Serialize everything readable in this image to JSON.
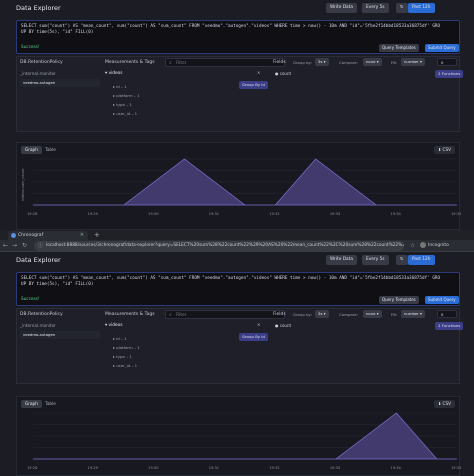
{
  "app": {
    "title": "Data Explorer",
    "write_data": "Write Data",
    "refresh": "Every 5s",
    "time_range": "Past 12h"
  },
  "query": {
    "text": "SELECT sum(\"count\") AS \"mean_count\", sum(\"count\") AS \"sum_count\" FROM \"veedmo\".\"autogen\".\"videos\" WHERE time > now() - 10m AND \"id\"='5fbe2f14bbd18533a36875df' GROUP BY time(5s), \"id\" FILL(0)",
    "status": "Success!",
    "query_templates": "Query Templates",
    "submit": "Submit Query"
  },
  "schema": {
    "db_header": "DB.RetentionPolicy",
    "databases": [
      "_internal.monitor",
      "veedmo.autogen"
    ],
    "meas_header": "Measurements & Tags",
    "filter_placeholder": "Filter",
    "measurement": "videos",
    "group_by_id": "Group By id",
    "tags": [
      "id – 1",
      "platform – 1",
      "type – 1",
      "user_id – 1"
    ],
    "fields_header": "Fields",
    "group_by_label": "Group by:",
    "group_by_value": "5s",
    "compare_label": "Compare:",
    "compare_value": "none",
    "fill_label": "Fill:",
    "fill_value": "number",
    "fill_number": "0",
    "field": "count",
    "functions": "2 Functions"
  },
  "chart": {
    "tabs": [
      "Graph",
      "Table"
    ],
    "csv": "CSV",
    "ylabel": "videos.sum_count",
    "xticks1": [
      "19:28",
      "19:29",
      "19:30",
      "19:31",
      "19:32",
      "19:33",
      "19:34",
      "19:35"
    ],
    "xticks2": [
      "19:28",
      "19:29",
      "19:30",
      "19:31",
      "19:32",
      "19:33",
      "19:34",
      "19:35"
    ]
  },
  "browser": {
    "tab_title": "Chronograf",
    "new_tab": "+",
    "url": "localhost:8888/sources/3/chronograf/data-explorer?query=SELECT%20sum%28%22count%22%29%20AS%20%22mean_count%22%2C%20sum%28%22count%22%29%20AS%20%22sum_count%22",
    "profile": "Incognito"
  },
  "colors": {
    "series_fill": "#4a3f7a",
    "series_stroke": "#7b6fd0",
    "accent": "#2a6cd6"
  },
  "chart_data": [
    {
      "type": "area",
      "title": "",
      "xlabel": "",
      "ylabel": "videos.sum_count",
      "series": [
        {
          "x": [
            "19:28",
            "19:29",
            "19:29:30",
            "19:30:30",
            "19:31:30",
            "19:32",
            "19:32:40",
            "19:33:40",
            "19:35"
          ],
          "values": [
            0,
            0,
            0,
            1,
            0,
            0,
            1,
            0,
            0
          ]
        }
      ]
    },
    {
      "type": "area",
      "title": "",
      "xlabel": "",
      "ylabel": "",
      "series": [
        {
          "x": [
            "19:28",
            "19:29",
            "19:30",
            "19:31",
            "19:32",
            "19:33",
            "19:34",
            "19:34:40",
            "19:35"
          ],
          "values": [
            0,
            0,
            0,
            0,
            0,
            0,
            1,
            0,
            0
          ]
        }
      ]
    }
  ]
}
